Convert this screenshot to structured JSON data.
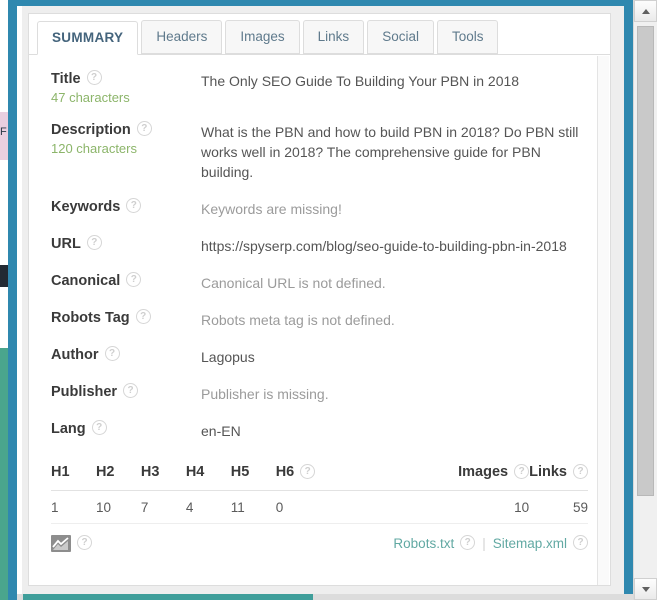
{
  "window": {
    "frame_color": "#2f88af",
    "accent_color": "#62a9a3"
  },
  "tabs": [
    {
      "label": "SUMMARY",
      "active": true
    },
    {
      "label": "Headers",
      "active": false
    },
    {
      "label": "Images",
      "active": false
    },
    {
      "label": "Links",
      "active": false
    },
    {
      "label": "Social",
      "active": false
    },
    {
      "label": "Tools",
      "active": false
    }
  ],
  "help_glyph": "?",
  "meta_rows": [
    {
      "label": "Title",
      "count": "47 characters",
      "value": "The Only SEO Guide To Building Your PBN in 2018",
      "muted": false
    },
    {
      "label": "Description",
      "count": "120 characters",
      "value": "What is the PBN and how to build PBN in 2018? Do PBN still works well in 2018? The comprehensive guide for PBN building.",
      "muted": false
    },
    {
      "label": "Keywords",
      "count": "",
      "value": "Keywords are missing!",
      "muted": true
    },
    {
      "label": "URL",
      "count": "",
      "value": "https://spyserp.com/blog/seo-guide-to-building-pbn-in-2018",
      "muted": false
    },
    {
      "label": "Canonical",
      "count": "",
      "value": "Canonical URL is not defined.",
      "muted": true
    },
    {
      "label": "Robots Tag",
      "count": "",
      "value": "Robots meta tag is not defined.",
      "muted": true
    },
    {
      "label": "Author",
      "count": "",
      "value": "Lagopus",
      "muted": false
    },
    {
      "label": "Publisher",
      "count": "",
      "value": "Publisher is missing.",
      "muted": true
    },
    {
      "label": "Lang",
      "count": "",
      "value": "en-EN",
      "muted": false
    }
  ],
  "counts_table": {
    "headers": [
      {
        "label": "H1",
        "help": false
      },
      {
        "label": "H2",
        "help": false
      },
      {
        "label": "H3",
        "help": false
      },
      {
        "label": "H4",
        "help": false
      },
      {
        "label": "H5",
        "help": false
      },
      {
        "label": "H6",
        "help": true
      },
      {
        "label": "Images",
        "help": true
      },
      {
        "label": "Links",
        "help": true
      }
    ],
    "values": [
      "1",
      "10",
      "7",
      "4",
      "11",
      "0",
      "10",
      "59"
    ]
  },
  "footer": {
    "chart_icon": "line-chart-icon",
    "robots_link": "Robots.txt",
    "separator": "|",
    "sitemap_link": "Sitemap.xml"
  }
}
